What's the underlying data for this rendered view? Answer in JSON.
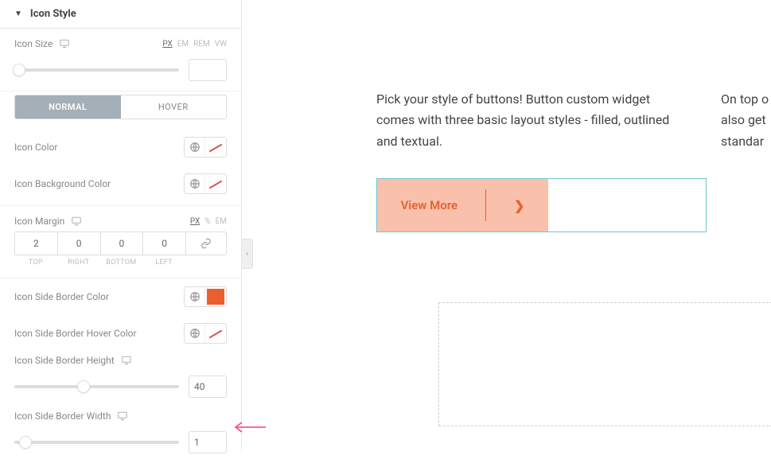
{
  "section": {
    "title": "Icon Style"
  },
  "iconSize": {
    "label": "Icon Size",
    "units": [
      "PX",
      "EM",
      "REM",
      "VW"
    ],
    "activeUnit": "PX"
  },
  "stateTabs": {
    "normal": "NORMAL",
    "hover": "HOVER"
  },
  "iconColor": {
    "label": "Icon Color"
  },
  "iconBg": {
    "label": "Icon Background Color"
  },
  "iconMargin": {
    "label": "Icon Margin",
    "units": [
      "PX",
      "%",
      "EM"
    ],
    "activeUnit": "PX",
    "top": "2",
    "right": "0",
    "bottom": "0",
    "left": "0",
    "lblTop": "TOP",
    "lblRight": "RIGHT",
    "lblBottom": "BOTTOM",
    "lblLeft": "LEFT"
  },
  "sideBorderColor": {
    "label": "Icon Side Border Color"
  },
  "sideBorderHover": {
    "label": "Icon Side Border Hover Color"
  },
  "sideBorderHeight": {
    "label": "Icon Side Border Height",
    "value": "40"
  },
  "sideBorderWidth": {
    "label": "Icon Side Border Width",
    "value": "1"
  },
  "preview": {
    "para1": "Pick your style of buttons! Button custom widget comes with three basic layout styles - filled, outlined and textual.",
    "para2a": "On top o",
    "para2b": "also get",
    "para2c": "standar",
    "ctaLabel": "View More"
  }
}
